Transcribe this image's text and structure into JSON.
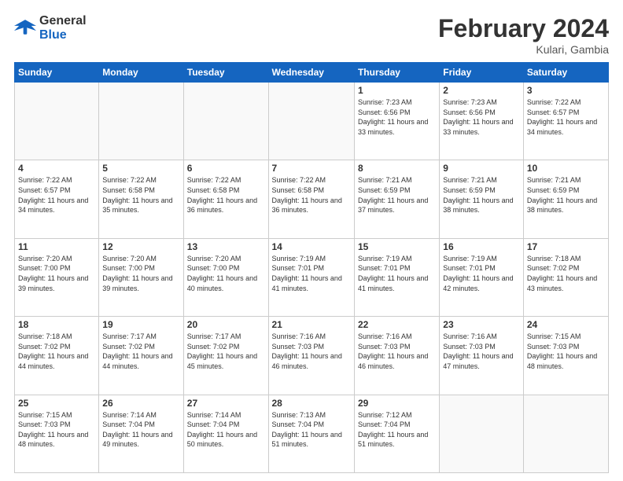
{
  "header": {
    "logo_general": "General",
    "logo_blue": "Blue",
    "month_year": "February 2024",
    "location": "Kulari, Gambia"
  },
  "weekdays": [
    "Sunday",
    "Monday",
    "Tuesday",
    "Wednesday",
    "Thursday",
    "Friday",
    "Saturday"
  ],
  "weeks": [
    [
      {
        "day": "",
        "empty": true
      },
      {
        "day": "",
        "empty": true
      },
      {
        "day": "",
        "empty": true
      },
      {
        "day": "",
        "empty": true
      },
      {
        "day": "1",
        "sunrise": "7:23 AM",
        "sunset": "6:56 PM",
        "daylight": "11 hours and 33 minutes."
      },
      {
        "day": "2",
        "sunrise": "7:23 AM",
        "sunset": "6:56 PM",
        "daylight": "11 hours and 33 minutes."
      },
      {
        "day": "3",
        "sunrise": "7:22 AM",
        "sunset": "6:57 PM",
        "daylight": "11 hours and 34 minutes."
      }
    ],
    [
      {
        "day": "4",
        "sunrise": "7:22 AM",
        "sunset": "6:57 PM",
        "daylight": "11 hours and 34 minutes."
      },
      {
        "day": "5",
        "sunrise": "7:22 AM",
        "sunset": "6:58 PM",
        "daylight": "11 hours and 35 minutes."
      },
      {
        "day": "6",
        "sunrise": "7:22 AM",
        "sunset": "6:58 PM",
        "daylight": "11 hours and 36 minutes."
      },
      {
        "day": "7",
        "sunrise": "7:22 AM",
        "sunset": "6:58 PM",
        "daylight": "11 hours and 36 minutes."
      },
      {
        "day": "8",
        "sunrise": "7:21 AM",
        "sunset": "6:59 PM",
        "daylight": "11 hours and 37 minutes."
      },
      {
        "day": "9",
        "sunrise": "7:21 AM",
        "sunset": "6:59 PM",
        "daylight": "11 hours and 38 minutes."
      },
      {
        "day": "10",
        "sunrise": "7:21 AM",
        "sunset": "6:59 PM",
        "daylight": "11 hours and 38 minutes."
      }
    ],
    [
      {
        "day": "11",
        "sunrise": "7:20 AM",
        "sunset": "7:00 PM",
        "daylight": "11 hours and 39 minutes."
      },
      {
        "day": "12",
        "sunrise": "7:20 AM",
        "sunset": "7:00 PM",
        "daylight": "11 hours and 39 minutes."
      },
      {
        "day": "13",
        "sunrise": "7:20 AM",
        "sunset": "7:00 PM",
        "daylight": "11 hours and 40 minutes."
      },
      {
        "day": "14",
        "sunrise": "7:19 AM",
        "sunset": "7:01 PM",
        "daylight": "11 hours and 41 minutes."
      },
      {
        "day": "15",
        "sunrise": "7:19 AM",
        "sunset": "7:01 PM",
        "daylight": "11 hours and 41 minutes."
      },
      {
        "day": "16",
        "sunrise": "7:19 AM",
        "sunset": "7:01 PM",
        "daylight": "11 hours and 42 minutes."
      },
      {
        "day": "17",
        "sunrise": "7:18 AM",
        "sunset": "7:02 PM",
        "daylight": "11 hours and 43 minutes."
      }
    ],
    [
      {
        "day": "18",
        "sunrise": "7:18 AM",
        "sunset": "7:02 PM",
        "daylight": "11 hours and 44 minutes."
      },
      {
        "day": "19",
        "sunrise": "7:17 AM",
        "sunset": "7:02 PM",
        "daylight": "11 hours and 44 minutes."
      },
      {
        "day": "20",
        "sunrise": "7:17 AM",
        "sunset": "7:02 PM",
        "daylight": "11 hours and 45 minutes."
      },
      {
        "day": "21",
        "sunrise": "7:16 AM",
        "sunset": "7:03 PM",
        "daylight": "11 hours and 46 minutes."
      },
      {
        "day": "22",
        "sunrise": "7:16 AM",
        "sunset": "7:03 PM",
        "daylight": "11 hours and 46 minutes."
      },
      {
        "day": "23",
        "sunrise": "7:16 AM",
        "sunset": "7:03 PM",
        "daylight": "11 hours and 47 minutes."
      },
      {
        "day": "24",
        "sunrise": "7:15 AM",
        "sunset": "7:03 PM",
        "daylight": "11 hours and 48 minutes."
      }
    ],
    [
      {
        "day": "25",
        "sunrise": "7:15 AM",
        "sunset": "7:03 PM",
        "daylight": "11 hours and 48 minutes."
      },
      {
        "day": "26",
        "sunrise": "7:14 AM",
        "sunset": "7:04 PM",
        "daylight": "11 hours and 49 minutes."
      },
      {
        "day": "27",
        "sunrise": "7:14 AM",
        "sunset": "7:04 PM",
        "daylight": "11 hours and 50 minutes."
      },
      {
        "day": "28",
        "sunrise": "7:13 AM",
        "sunset": "7:04 PM",
        "daylight": "11 hours and 51 minutes."
      },
      {
        "day": "29",
        "sunrise": "7:12 AM",
        "sunset": "7:04 PM",
        "daylight": "11 hours and 51 minutes."
      },
      {
        "day": "",
        "empty": true
      },
      {
        "day": "",
        "empty": true
      }
    ]
  ]
}
